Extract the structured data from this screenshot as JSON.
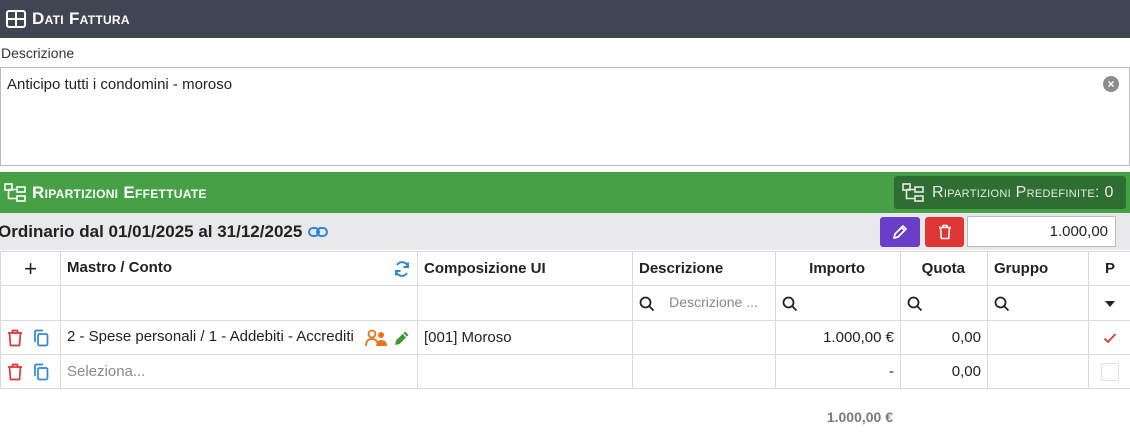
{
  "header": {
    "title": "Dati Fattura",
    "icon": "table-icon"
  },
  "descrizione": {
    "label": "Descrizione",
    "value": "Anticipo tutti i condomini - moroso"
  },
  "ripartizioni": {
    "title": "Ripartizioni Effettuate",
    "predefinite_label": "Ripartizioni Predefinite: 0"
  },
  "periodo": {
    "label": "Ordinario dal 01/01/2025 al 31/12/2025",
    "amount": "1.000,00"
  },
  "colors": {
    "header_bg": "#404552",
    "green": "#46a046",
    "dark_green": "#2e6e31",
    "purple": "#6a3ec8",
    "red": "#e03535"
  },
  "table": {
    "add_symbol": "+",
    "columns": [
      "Mastro / Conto",
      "Composizione UI",
      "Descrizione",
      "Importo",
      "Quota",
      "Gruppo",
      "P"
    ],
    "filter_placeholder": "Descrizione ...",
    "rows": [
      {
        "conto": "2 - Spese personali / 1 - Addebiti - Accrediti",
        "composizione": "[001] Moroso",
        "descrizione": "",
        "importo": "1.000,00 €",
        "quota": "0,00",
        "gruppo": "",
        "p_checked": true
      },
      {
        "conto": "Seleziona...",
        "composizione": "",
        "descrizione": "",
        "importo": "-",
        "quota": "0,00",
        "gruppo": "",
        "p_checked": false
      }
    ],
    "total": "1.000,00 €"
  }
}
